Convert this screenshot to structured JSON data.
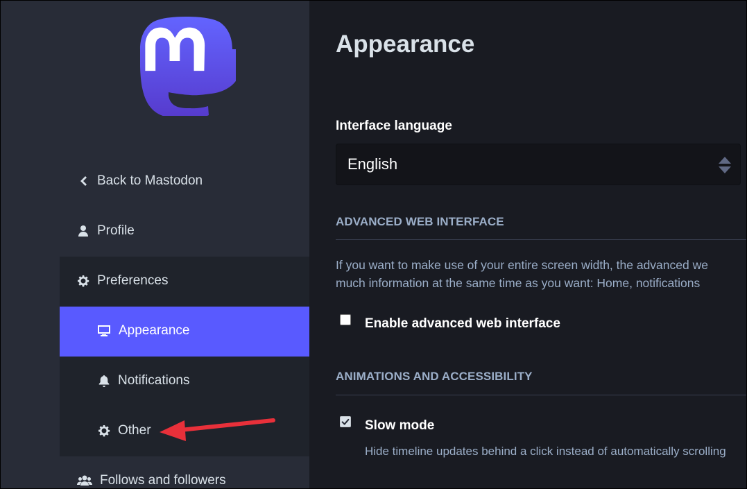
{
  "sidebar": {
    "logo": "mastodon-logo",
    "items": [
      {
        "label": "Back to Mastodon",
        "icon": "chevron-left-icon"
      },
      {
        "label": "Profile",
        "icon": "user-icon"
      },
      {
        "label": "Preferences",
        "icon": "gear-icon"
      },
      {
        "label": "Appearance",
        "icon": "desktop-icon",
        "active": true
      },
      {
        "label": "Notifications",
        "icon": "bell-icon"
      },
      {
        "label": "Other",
        "icon": "gear-icon"
      },
      {
        "label": "Follows and followers",
        "icon": "users-icon"
      }
    ],
    "annotation": "red-arrow-pointing-to-other"
  },
  "main": {
    "title": "Appearance",
    "language": {
      "label": "Interface language",
      "value": "English"
    },
    "advanced": {
      "heading": "ADVANCED WEB INTERFACE",
      "description_line1": "If you want to make use of your entire screen width, the advanced we",
      "description_line2": "much information at the same time as you want: Home, notifications",
      "checkbox_label": "Enable advanced web interface",
      "checked": false
    },
    "animations": {
      "heading": "ANIMATIONS AND ACCESSIBILITY",
      "slow_mode_label": "Slow mode",
      "slow_mode_checked": true,
      "slow_mode_hint": "Hide timeline updates behind a click instead of automatically scrolling"
    }
  },
  "colors": {
    "accent": "#595aff",
    "sidebar": "#282c37",
    "background": "#191b22",
    "arrow": "#e8303a"
  }
}
